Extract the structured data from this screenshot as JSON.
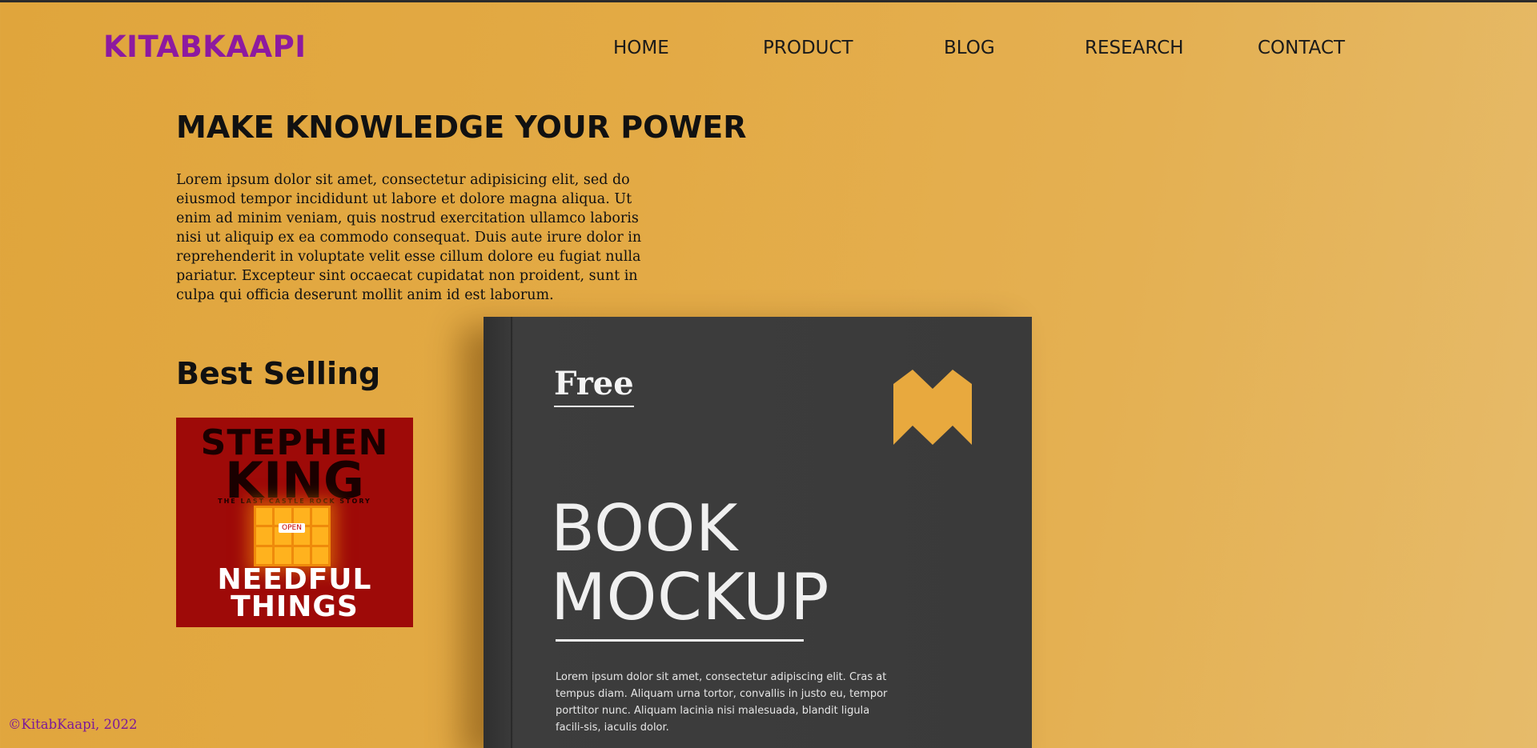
{
  "brand": {
    "logo": "KITABKAAPI"
  },
  "nav": {
    "items": [
      {
        "label": "HOME"
      },
      {
        "label": "PRODUCT"
      },
      {
        "label": "BLOG"
      },
      {
        "label": "RESEARCH"
      },
      {
        "label": "CONTACT"
      }
    ]
  },
  "hero": {
    "headline": "MAKE KNOWLEDGE YOUR POWER",
    "intro": "Lorem ipsum dolor sit amet, consectetur adipisicing elit, sed do eiusmod tempor incididunt ut labore et dolore magna aliqua. Ut enim ad minim veniam, quis nostrud exercitation ullamco laboris nisi ut aliquip ex ea commodo consequat. Duis aute irure dolor in reprehenderit in voluptate velit esse cillum dolore eu fugiat nulla pariatur. Excepteur sint occaecat cupidatat non proident, sunt in culpa qui officia deserunt mollit anim id est laborum."
  },
  "best_selling": {
    "title": "Best Selling",
    "book": {
      "author": "STEPHEN",
      "author_last": "KING",
      "tagline": "THE LAST CASTLE ROCK STORY",
      "sign": "OPEN",
      "title_line1": "NEEDFUL",
      "title_line2": "THINGS"
    }
  },
  "mockup": {
    "badge": "Free",
    "title_line1": "BOOK",
    "title_line2": "MOCKUP",
    "body": "Lorem ipsum dolor sit amet, consectetur adipiscing elit. Cras at tempus diam. Aliquam urna tortor, convallis in justo eu, tempor porttitor nunc. Aliquam lacinia nisi malesuada, blandit ligula facili-sis, iaculis dolor.",
    "mark_icon": "m-logo-icon",
    "mark_color": "#e8a93e"
  },
  "footer": {
    "copyright": "©KitabKaapi, 2022"
  },
  "colors": {
    "background": "#e3aa45",
    "logo": "#8d1aa0",
    "footer_text": "#7d1a99",
    "cover_red": "#9e0a08"
  }
}
